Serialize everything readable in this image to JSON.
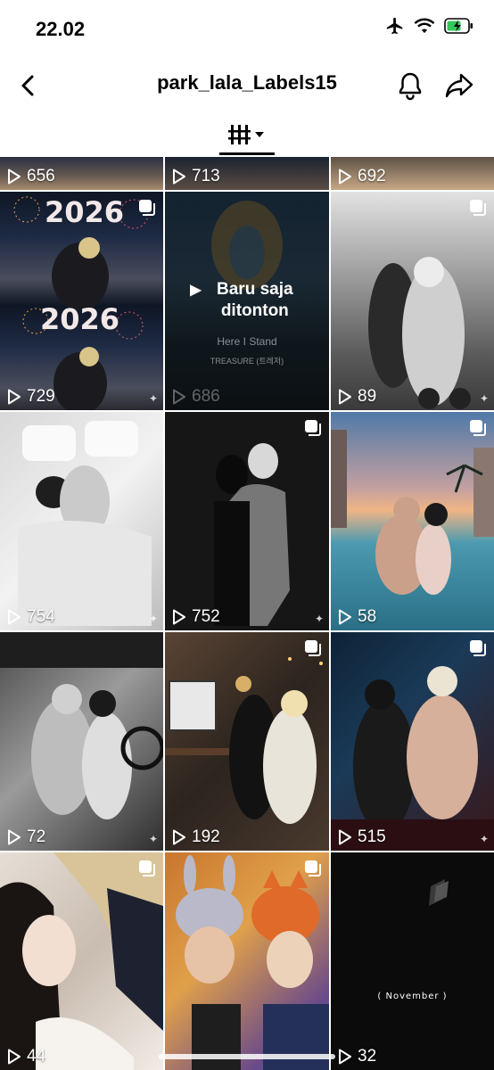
{
  "status": {
    "time": "22.02"
  },
  "header": {
    "title": "park_lala_Labels15"
  },
  "icons": {
    "back": "chevron-left-icon",
    "bell": "bell-icon",
    "share": "share-arrow-icon",
    "view": "grid-view-icon",
    "play": "play-icon",
    "multi": "multi-photo-icon",
    "airplane": "airplane-icon",
    "wifi": "wifi-icon",
    "battery": "battery-charging-icon"
  },
  "grid": {
    "items": [
      {
        "count": "656",
        "multi": false
      },
      {
        "count": "713",
        "multi": false
      },
      {
        "count": "692",
        "multi": false
      },
      {
        "count": "729",
        "multi": true,
        "image_text": "2026"
      },
      {
        "count": "686",
        "multi": false,
        "watched": true,
        "watched_label": "Baru saja ditonton",
        "song_title": "Here I Stand",
        "song_artist": "TREASURE (트레저)"
      },
      {
        "count": "89",
        "multi": true
      },
      {
        "count": "754",
        "multi": false
      },
      {
        "count": "752",
        "multi": true
      },
      {
        "count": "58",
        "multi": true
      },
      {
        "count": "72",
        "multi": false
      },
      {
        "count": "192",
        "multi": true
      },
      {
        "count": "515",
        "multi": true
      },
      {
        "count": "44",
        "multi": true
      },
      {
        "count": "",
        "multi": true
      },
      {
        "count": "32",
        "multi": false,
        "image_text": "( November )"
      }
    ]
  },
  "colors": {
    "accent": "#000000",
    "background": "#ffffff",
    "battery": "#34c759"
  }
}
